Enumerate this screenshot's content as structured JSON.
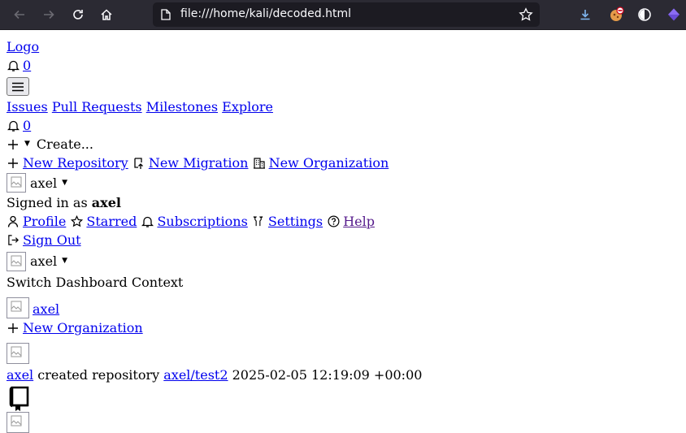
{
  "browser": {
    "url": "file:///home/kali/decoded.html"
  },
  "header": {
    "logo_label": "Logo",
    "notif_count": "0",
    "nav": [
      "Issues",
      "Pull Requests",
      "Milestones",
      "Explore"
    ],
    "notif_count_2": "0",
    "create_label": "Create...",
    "create_menu": [
      "New Repository",
      "New Migration",
      "New Organization"
    ],
    "user_name": "axel",
    "signed_in_prefix": "Signed in as",
    "signed_in_user": "axel",
    "user_menu": [
      "Profile",
      "Starred",
      "Subscriptions",
      "Settings",
      "Help"
    ],
    "sign_out": "Sign Out"
  },
  "dashboard": {
    "context_user": "axel",
    "switch_label": "Switch Dashboard Context",
    "context_item": "axel",
    "new_org": "New Organization"
  },
  "feed": {
    "actor": "axel",
    "action": "created repository",
    "repo": "axel/test2",
    "timestamp": "2025-02-05 12:19:09 +00:00"
  }
}
